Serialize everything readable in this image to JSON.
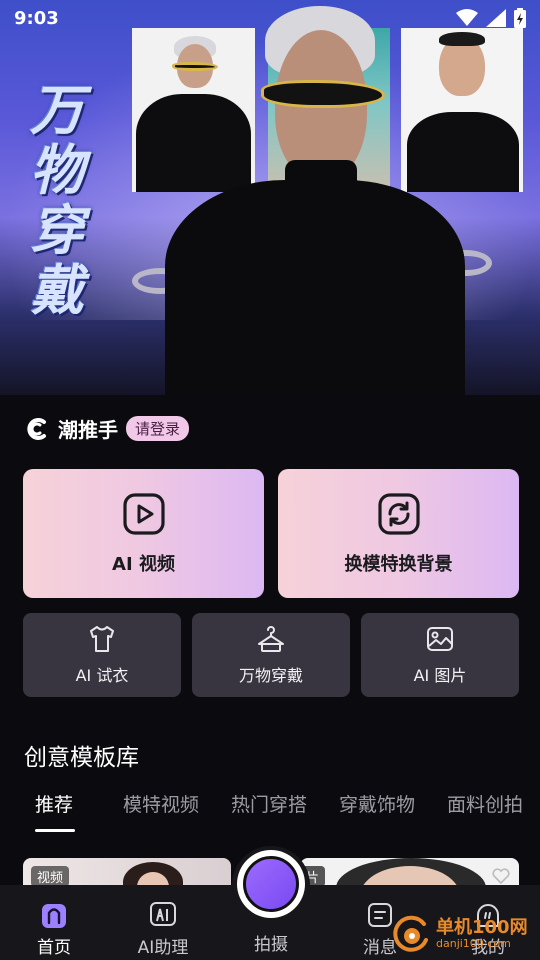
{
  "status_bar": {
    "time": "9:03"
  },
  "hero": {
    "title_chars": [
      "万",
      "物",
      "穿",
      "戴"
    ]
  },
  "brand": {
    "name": "潮推手",
    "login_label": "请登录"
  },
  "features_big": [
    {
      "label": "AI 视频",
      "icon": "video-play-icon"
    },
    {
      "label": "换模特换背景",
      "icon": "swap-refresh-icon"
    }
  ],
  "features_small": [
    {
      "label": "AI 试衣",
      "icon": "shirt-icon"
    },
    {
      "label": "万物穿戴",
      "icon": "hanger-icon"
    },
    {
      "label": "AI 图片",
      "icon": "image-icon"
    }
  ],
  "section": {
    "title": "创意模板库",
    "tabs": [
      "推荐",
      "模特视频",
      "热门穿搭",
      "穿戴饰物",
      "面料创拍"
    ],
    "active_tab": 0
  },
  "preview": {
    "badges": [
      "视频",
      "片"
    ]
  },
  "bottom_nav": {
    "items": [
      {
        "label": "首页",
        "icon": "home-icon"
      },
      {
        "label": "AI助理",
        "icon": "ai-assistant-icon"
      },
      {
        "label": "拍摄",
        "icon": "shoot-icon"
      },
      {
        "label": "消息",
        "icon": "message-icon"
      },
      {
        "label": "我的",
        "icon": "profile-icon"
      }
    ],
    "active_index": 0
  },
  "watermark": {
    "line1": "单机100网",
    "line2": "danji100.com"
  },
  "colors": {
    "background": "#0b0b0f",
    "card_gradient_start": "#f6d2d8",
    "card_gradient_end": "#dcb8f3",
    "small_card": "#393540",
    "accent_purple": "#8a58f8",
    "login_badge": "#f1c8e8"
  }
}
